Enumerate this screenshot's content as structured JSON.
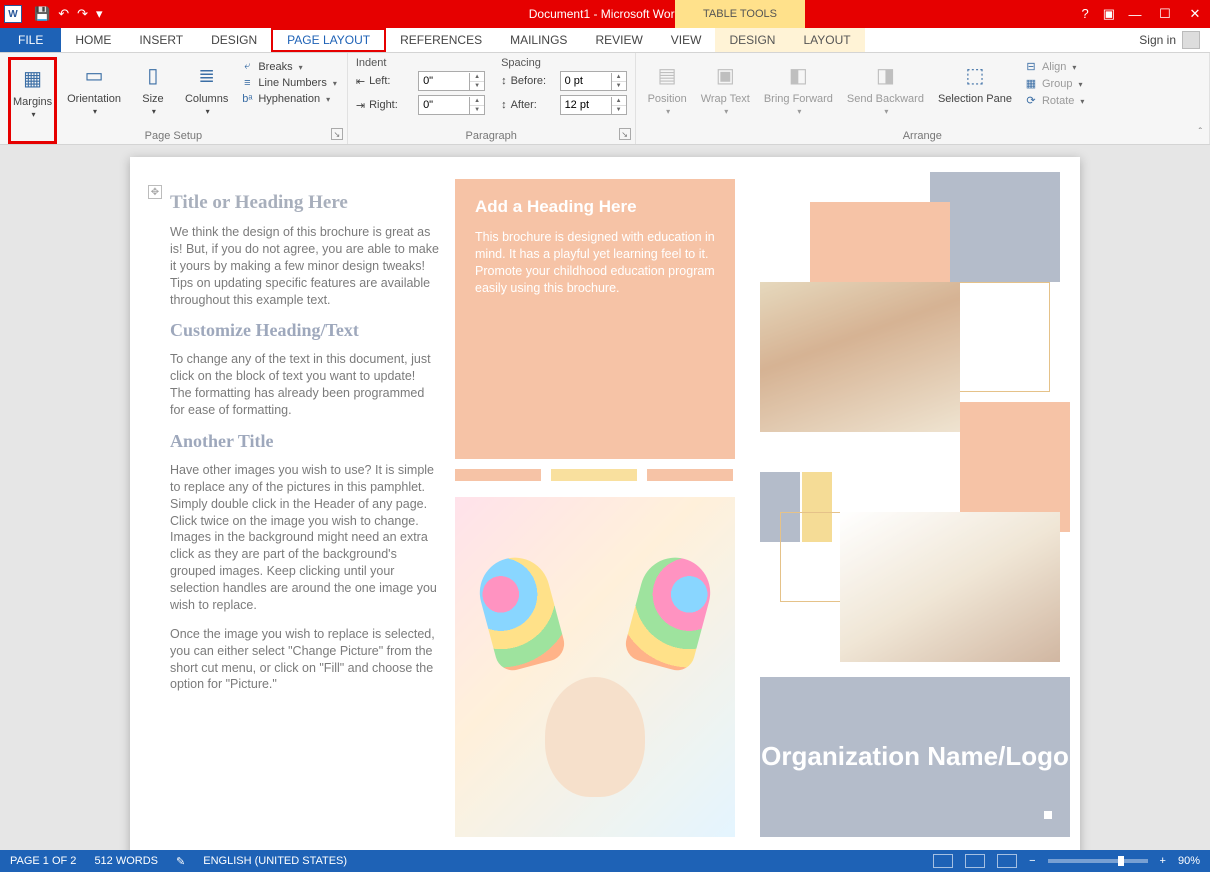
{
  "title": "Document1 - Microsoft Word",
  "contextual_tab_title": "TABLE TOOLS",
  "qat": {
    "save": "💾",
    "undo": "↶",
    "redo": "↷"
  },
  "tabs": {
    "file": "FILE",
    "items": [
      "HOME",
      "INSERT",
      "DESIGN",
      "PAGE LAYOUT",
      "REFERENCES",
      "MAILINGS",
      "REVIEW",
      "VIEW"
    ],
    "context": [
      "DESIGN",
      "LAYOUT"
    ],
    "active": "PAGE LAYOUT"
  },
  "signin": "Sign in",
  "ribbon": {
    "page_setup": {
      "label": "Page Setup",
      "margins": "Margins",
      "orientation": "Orientation",
      "size": "Size",
      "columns": "Columns",
      "breaks": "Breaks",
      "line_numbers": "Line Numbers",
      "hyphenation": "Hyphenation"
    },
    "paragraph": {
      "label": "Paragraph",
      "indent_label": "Indent",
      "spacing_label": "Spacing",
      "left_label": "Left:",
      "right_label": "Right:",
      "before_label": "Before:",
      "after_label": "After:",
      "left_value": "0\"",
      "right_value": "0\"",
      "before_value": "0 pt",
      "after_value": "12 pt"
    },
    "arrange": {
      "label": "Arrange",
      "position": "Position",
      "wrap": "Wrap Text",
      "forward": "Bring Forward",
      "backward": "Send Backward",
      "pane": "Selection Pane",
      "align": "Align",
      "group": "Group",
      "rotate": "Rotate"
    }
  },
  "document": {
    "h1": "Title or Heading Here",
    "p1": "We think the design of this brochure is great as is!  But, if you do not agree, you are able to make it yours by making a few minor design tweaks!  Tips on updating specific features are available throughout this example text.",
    "h2": "Customize Heading/Text",
    "p2": "To change any of the text in this document, just click on the block of text you want to update!  The formatting has already been programmed for ease of formatting.",
    "h3": "Another Title",
    "p3": "Have other images you wish to use?  It is simple to replace any of the pictures in this pamphlet.  Simply double click in the Header of any page.  Click twice on the image you wish to change.  Images in the background might need an extra click as they are part of the background's grouped images.  Keep clicking until your selection handles are around the one image you wish to replace.",
    "p4": "Once the image you wish to replace is selected, you can either select \"Change Picture\" from the short cut menu, or click on \"Fill\" and choose the option for \"Picture.\"",
    "orange_h": "Add a Heading Here",
    "orange_p": "This brochure is designed with education in mind.  It has a playful yet learning feel to it.  Promote your childhood education program easily using this brochure.",
    "org": "Organization Name/Logo"
  },
  "status": {
    "page": "PAGE 1 OF 2",
    "words": "512 WORDS",
    "lang": "ENGLISH (UNITED STATES)",
    "zoom": "90%"
  }
}
